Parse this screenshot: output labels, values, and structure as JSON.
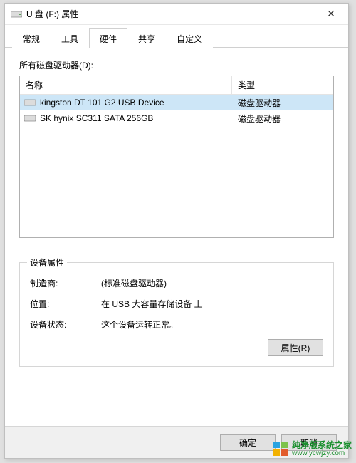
{
  "window": {
    "title": "U 盘 (F:) 属性",
    "close_glyph": "✕"
  },
  "tabs": {
    "t0": "常规",
    "t1": "工具",
    "t2": "硬件",
    "t3": "共享",
    "t4": "自定义"
  },
  "hardware": {
    "list_label": "所有磁盘驱动器(D):",
    "col_name": "名称",
    "col_type": "类型",
    "rows": [
      {
        "name": "kingston DT 101 G2 USB Device",
        "type": "磁盘驱动器",
        "selected": true
      },
      {
        "name": "SK hynix SC311 SATA 256GB",
        "type": "磁盘驱动器",
        "selected": false
      }
    ]
  },
  "device_props": {
    "group_title": "设备属性",
    "manufacturer_label": "制造商:",
    "manufacturer_value": "(标准磁盘驱动器)",
    "location_label": "位置:",
    "location_value": "在 USB 大容量存储设备 上",
    "status_label": "设备状态:",
    "status_value": "这个设备运转正常。",
    "props_button": "属性(R)"
  },
  "footer": {
    "ok": "确定",
    "cancel": "取消"
  },
  "watermark": {
    "line1": "纯净版系统之家",
    "line2": "www.ycwjzy.com"
  }
}
